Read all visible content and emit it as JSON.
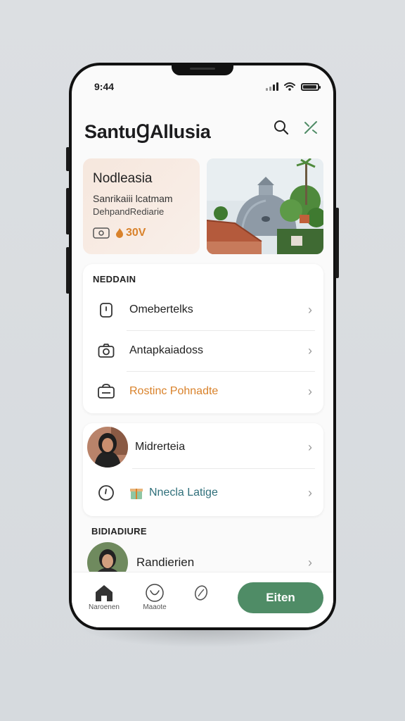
{
  "status_bar": {
    "time": "9:44"
  },
  "header": {
    "title": "SantuꞬAllusia"
  },
  "promo": {
    "title": "Nodleasia",
    "subtitle": "Sanrikaiii lcatmam",
    "subtitle2": "DehpandRediarie",
    "price": "30V"
  },
  "settings_section": {
    "label": "NEDDAIN",
    "items": [
      {
        "label": "Omebertelks",
        "icon": "lock-icon"
      },
      {
        "label": "Antapkaiadoss",
        "icon": "camera-icon"
      },
      {
        "label": "Rostinc Pohnadte",
        "icon": "bag-icon",
        "color": "#d9822b"
      }
    ]
  },
  "people_section": {
    "items": [
      {
        "label": "Midrerteia",
        "icon": "avatar"
      },
      {
        "label": "Nnecla Latige",
        "icon": "clock-icon",
        "color": "#2f6f7a"
      }
    ]
  },
  "bottom_section": {
    "label": "BIDIADIURE",
    "items": [
      {
        "label": "Randierien",
        "icon": "avatar"
      }
    ]
  },
  "bottom_nav": {
    "items": [
      {
        "label": "Naroenen",
        "icon": "home-icon"
      },
      {
        "label": "Maaote",
        "icon": "heart-icon"
      },
      {
        "label": "",
        "icon": "leaf-icon"
      }
    ],
    "cta_label": "Eiten"
  },
  "colors": {
    "accent": "#4f8c66",
    "orange": "#d9822b",
    "teal": "#2f6f7a"
  }
}
